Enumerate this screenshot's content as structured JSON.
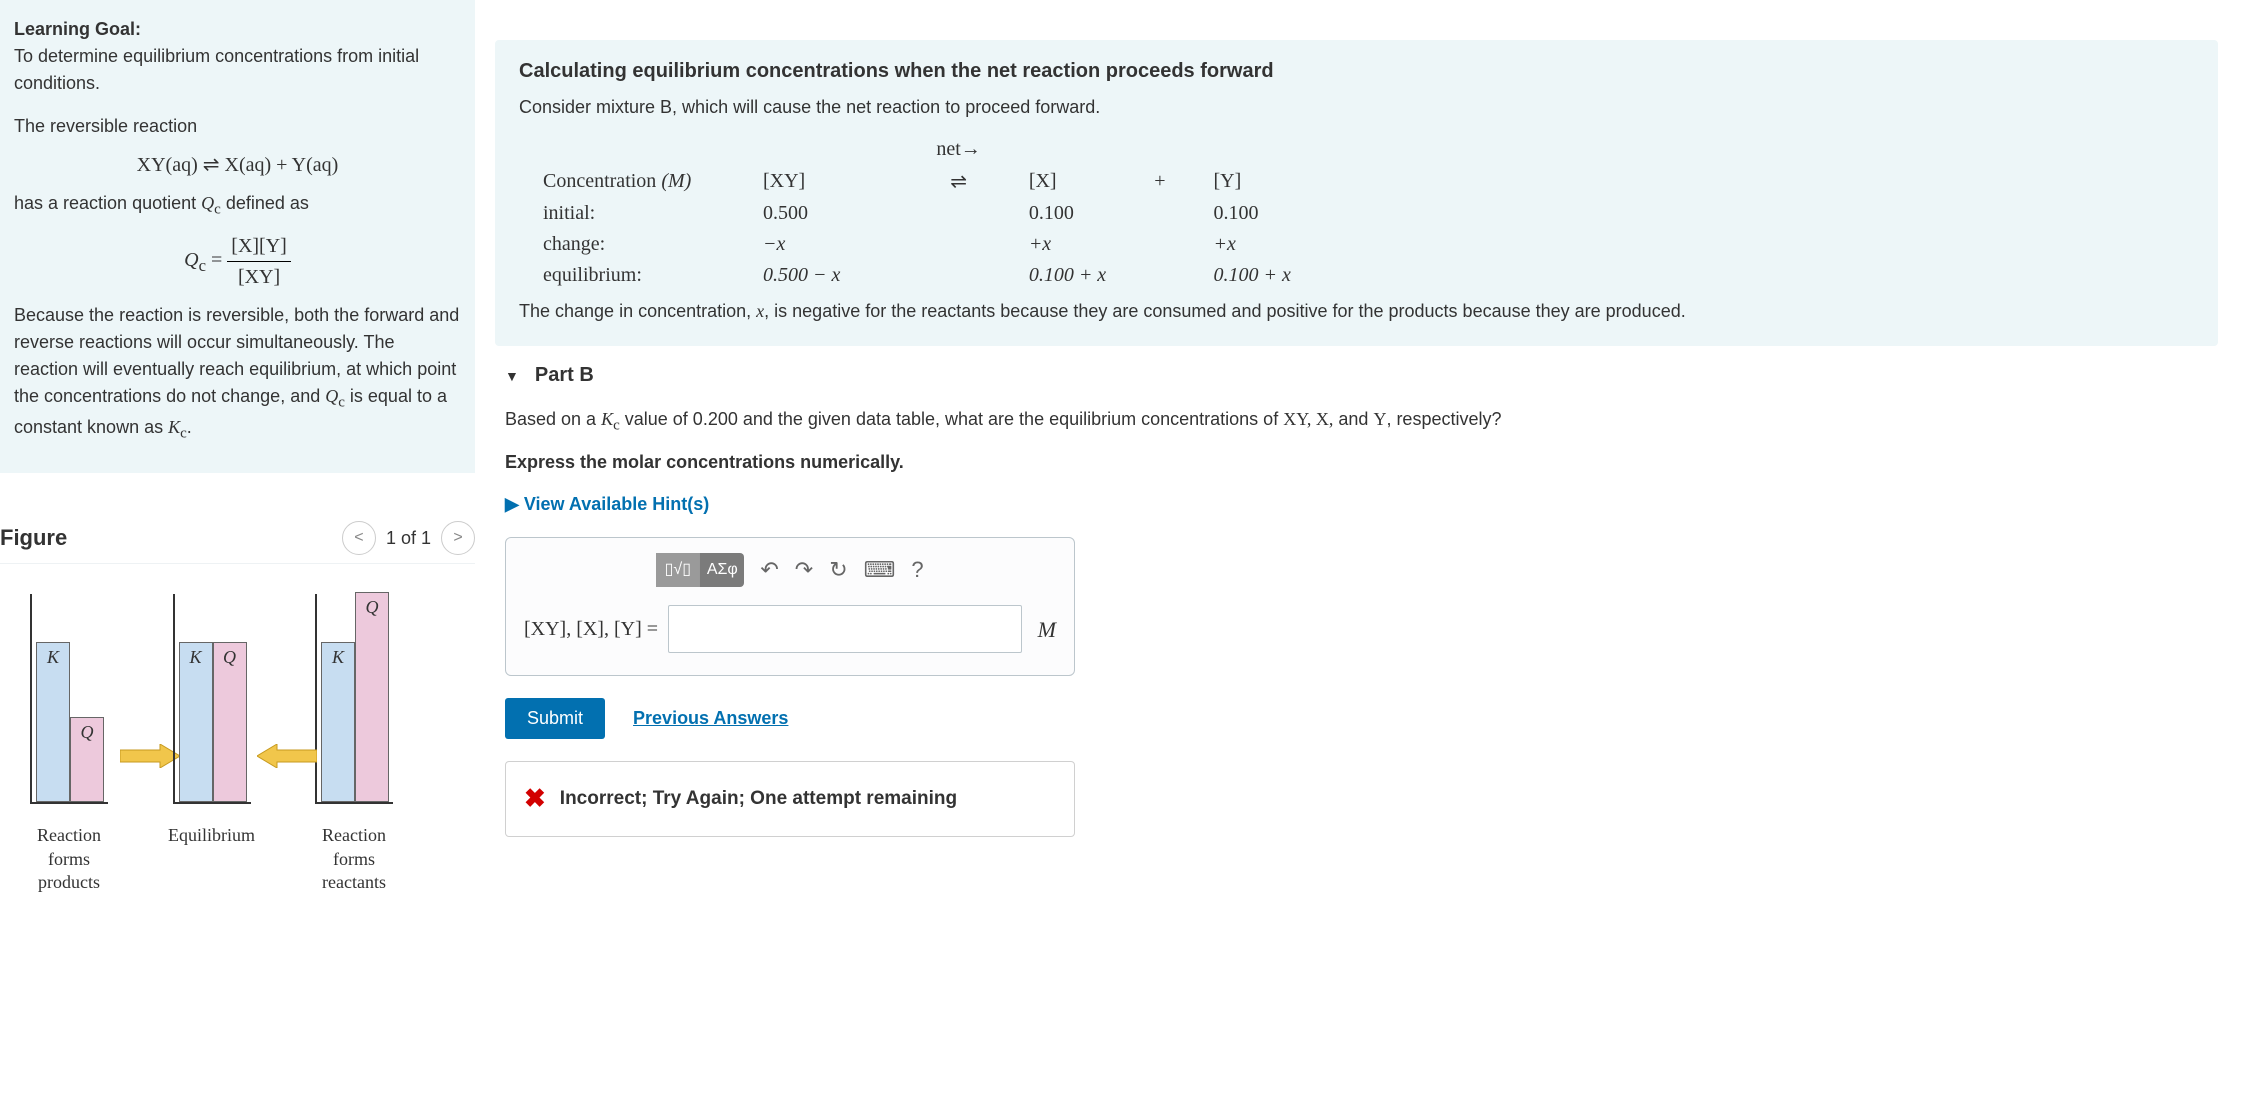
{
  "left": {
    "goal_label": "Learning Goal:",
    "goal_text": "To determine equilibrium concentrations from initial conditions.",
    "rev_intro": "The reversible reaction",
    "rev_eq": "XY(aq) ⇌ X(aq) + Y(aq)",
    "qc_intro_a": "has a reaction quotient ",
    "qc_sym": "Q",
    "qc_sub": "c",
    "qc_intro_b": " defined as",
    "qc_lhs": "Q",
    "qc_eq": " = ",
    "qc_num": "[X][Y]",
    "qc_den": "[XY]",
    "explain_a": "Because the reaction is reversible, both the forward and reverse reactions will occur simultaneously. The reaction will eventually reach equilibrium, at which point the concentrations do not change, and ",
    "explain_b": " is equal to a constant known as ",
    "kc_sym": "K",
    "kc_sub": "c",
    "period": "."
  },
  "figure": {
    "title": "Figure",
    "nav_label": "1 of 1",
    "labels": {
      "K": "K",
      "Q": "Q"
    },
    "captions": {
      "g1a": "Reaction",
      "g1b": "forms",
      "g1c": "products",
      "g2": "Equilibrium",
      "g3a": "Reaction",
      "g3b": "forms",
      "g3c": "reactants"
    }
  },
  "hint": {
    "title": "Calculating equilibrium concentrations when the net reaction proceeds forward",
    "intro": "Consider mixture B, which will cause the net reaction to proceed forward.",
    "net_label": "net→",
    "col_conc": "Concentration",
    "col_conc_unit": "(M)",
    "col_xy": "[XY]",
    "col_arrow": "⇌",
    "col_x": "[X]",
    "col_plus": "+",
    "col_y": "[Y]",
    "row_init": "initial:",
    "row_change": "change:",
    "row_eq": "equilibrium:",
    "v_init_xy": "0.500",
    "v_init_x": "0.100",
    "v_init_y": "0.100",
    "v_ch_xy": "−x",
    "v_ch_x": "+x",
    "v_ch_y": "+x",
    "v_eq_xy": "0.500 − x",
    "v_eq_x": "0.100 + x",
    "v_eq_y": "0.100 + x",
    "note_a": "The change in concentration, ",
    "note_x": "x",
    "note_b": ", is negative for the reactants because they are consumed and positive for the products because they are produced."
  },
  "partB": {
    "label": "Part B",
    "q_a": "Based on a ",
    "q_kc": "K",
    "q_kc_sub": "c",
    "q_b": " value of 0.200 and the given data table, what are the equilibrium concentrations of  ",
    "q_species": "XY, X,",
    "q_and": " and ",
    "q_y": "Y",
    "q_c": ", respectively?",
    "instr": "Express the molar concentrations numerically.",
    "hints_link": "View Available Hint(s)",
    "tool_fmt": "▯√▯",
    "tool_greek": "ΑΣφ",
    "tool_undo": "↶",
    "tool_redo": "↷",
    "tool_reset": "↻",
    "tool_kbd": "⌨",
    "tool_help": "?",
    "input_lbl": "[XY], [X], [Y] =",
    "unit": "M",
    "submit": "Submit",
    "prev": "Previous Answers",
    "fb_icon": "✖",
    "fb_msg": "Incorrect; Try Again; One attempt remaining"
  }
}
